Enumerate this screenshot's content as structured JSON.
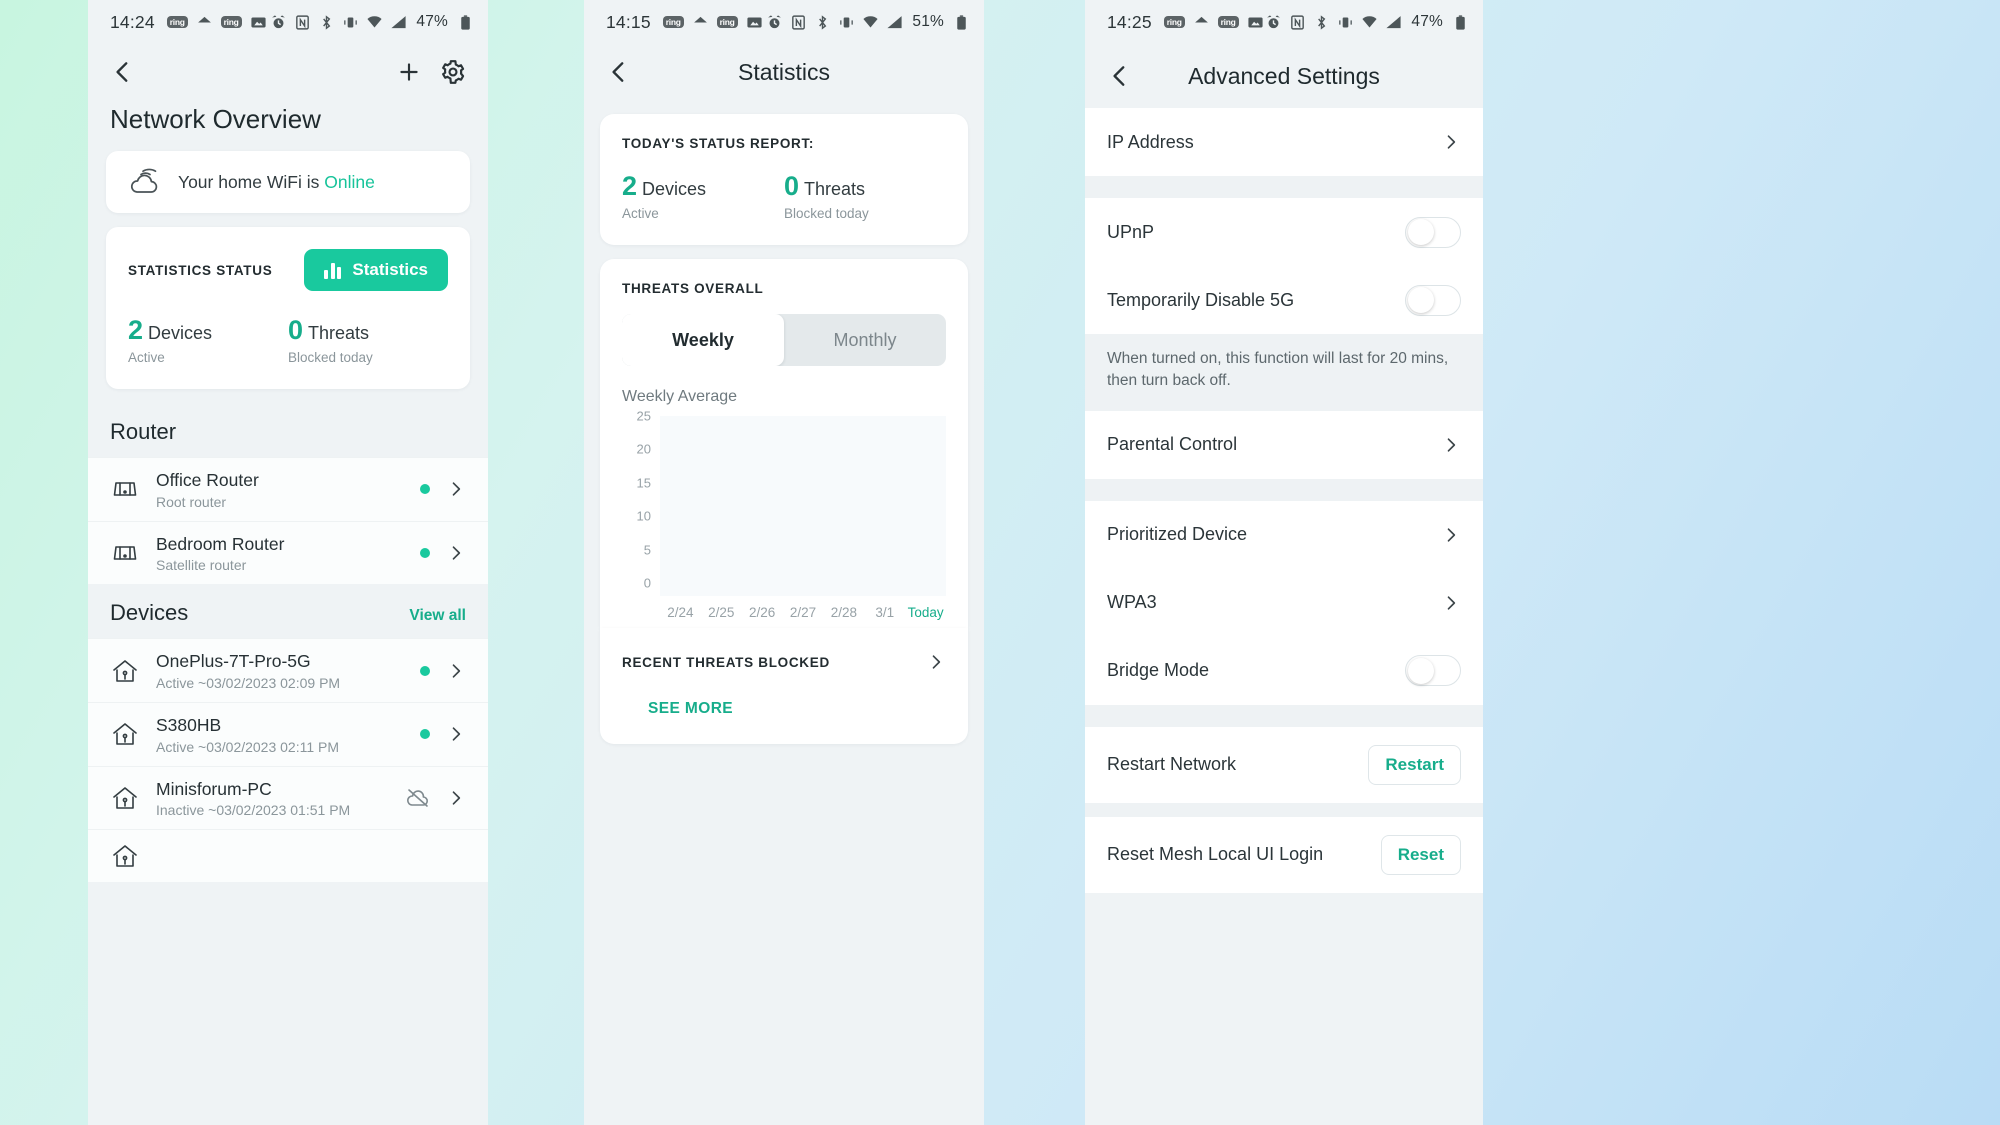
{
  "panel1": {
    "statusbar": {
      "time": "14:24",
      "battery": "47%",
      "icons": [
        "ring-chip",
        "home-icon",
        "ring-chip",
        "image-icon",
        "alarm-icon",
        "nfc-icon",
        "bluetooth-icon",
        "vibrate-icon",
        "wifi-icon",
        "signal-icon",
        "battery-icon"
      ]
    },
    "nav": {
      "back": "back-icon",
      "add": "plus-icon",
      "settings": "gear-icon"
    },
    "title": "Network Overview",
    "wifi_card": {
      "text_prefix": "Your home WiFi is ",
      "status": "Online",
      "status_color": "#17c39a"
    },
    "stats_card": {
      "label": "STATISTICS STATUS",
      "button": "Statistics",
      "metrics": [
        {
          "num": "2",
          "unit": "Devices",
          "sub": "Active"
        },
        {
          "num": "0",
          "unit": "Threats",
          "sub": "Blocked today"
        }
      ]
    },
    "router_section": {
      "heading": "Router"
    },
    "routers": [
      {
        "name": "Office Router",
        "sub": "Root router",
        "status": "online"
      },
      {
        "name": "Bedroom Router",
        "sub": "Satellite router",
        "status": "online"
      }
    ],
    "devices_section": {
      "heading": "Devices",
      "link": "View all"
    },
    "devices": [
      {
        "name": "OnePlus-7T-Pro-5G",
        "sub": "Active ~03/02/2023 02:09 PM",
        "status": "online"
      },
      {
        "name": "S380HB",
        "sub": "Active ~03/02/2023 02:11 PM",
        "status": "online"
      },
      {
        "name": "Minisforum-PC",
        "sub": "Inactive ~03/02/2023 01:51 PM",
        "status": "offline"
      }
    ]
  },
  "panel2": {
    "statusbar": {
      "time": "14:15",
      "battery": "51%"
    },
    "title": "Statistics",
    "status_report": {
      "label": "TODAY'S STATUS REPORT:",
      "metrics": [
        {
          "num": "2",
          "unit": "Devices",
          "sub": "Active"
        },
        {
          "num": "0",
          "unit": "Threats",
          "sub": "Blocked today"
        }
      ]
    },
    "threats_overall": {
      "label": "THREATS OVERALL",
      "tabs": [
        {
          "label": "Weekly",
          "active": true
        },
        {
          "label": "Monthly",
          "active": false
        }
      ]
    },
    "recent": {
      "label": "RECENT THREATS BLOCKED",
      "see_more": "SEE MORE"
    }
  },
  "panel3": {
    "statusbar": {
      "time": "14:25",
      "battery": "47%"
    },
    "title": "Advanced Settings",
    "items": [
      {
        "label": "IP Address",
        "control": "chevron"
      },
      {
        "label": "UPnP",
        "control": "toggle",
        "on": false
      },
      {
        "label": "Temporarily Disable 5G",
        "control": "toggle",
        "on": false
      },
      {
        "label": "Parental Control",
        "control": "chevron"
      },
      {
        "label": "Prioritized Device",
        "control": "chevron"
      },
      {
        "label": "WPA3",
        "control": "chevron"
      },
      {
        "label": "Bridge Mode",
        "control": "toggle",
        "on": false
      },
      {
        "label": "Restart Network",
        "control": "button",
        "button": "Restart"
      },
      {
        "label": "Reset Mesh Local UI Login",
        "control": "button",
        "button": "Reset"
      }
    ],
    "note": "When turned on, this function will last for 20 mins, then turn back off."
  },
  "chart_data": {
    "type": "bar",
    "title": "Weekly Average",
    "categories": [
      "2/24",
      "2/25",
      "2/26",
      "2/27",
      "2/28",
      "3/1",
      "Today"
    ],
    "values": [
      0,
      0,
      0,
      0,
      0,
      0,
      0
    ],
    "ylabel": "",
    "xlabel": "",
    "yticks": [
      "25",
      "20",
      "15",
      "10",
      "5",
      "0"
    ],
    "ylim": [
      0,
      25
    ],
    "grid": false,
    "legend": "none",
    "highlight_category": "Today",
    "highlight_color": "#17ad8b",
    "plot_bg": "#f7fafc"
  },
  "theme": {
    "accent": "#19c99e",
    "accent_dark": "#17ad8b",
    "text": "#1f2a2e",
    "muted": "#8b969b",
    "panel_bg": "#eff3f5",
    "card_bg": "#ffffff"
  }
}
